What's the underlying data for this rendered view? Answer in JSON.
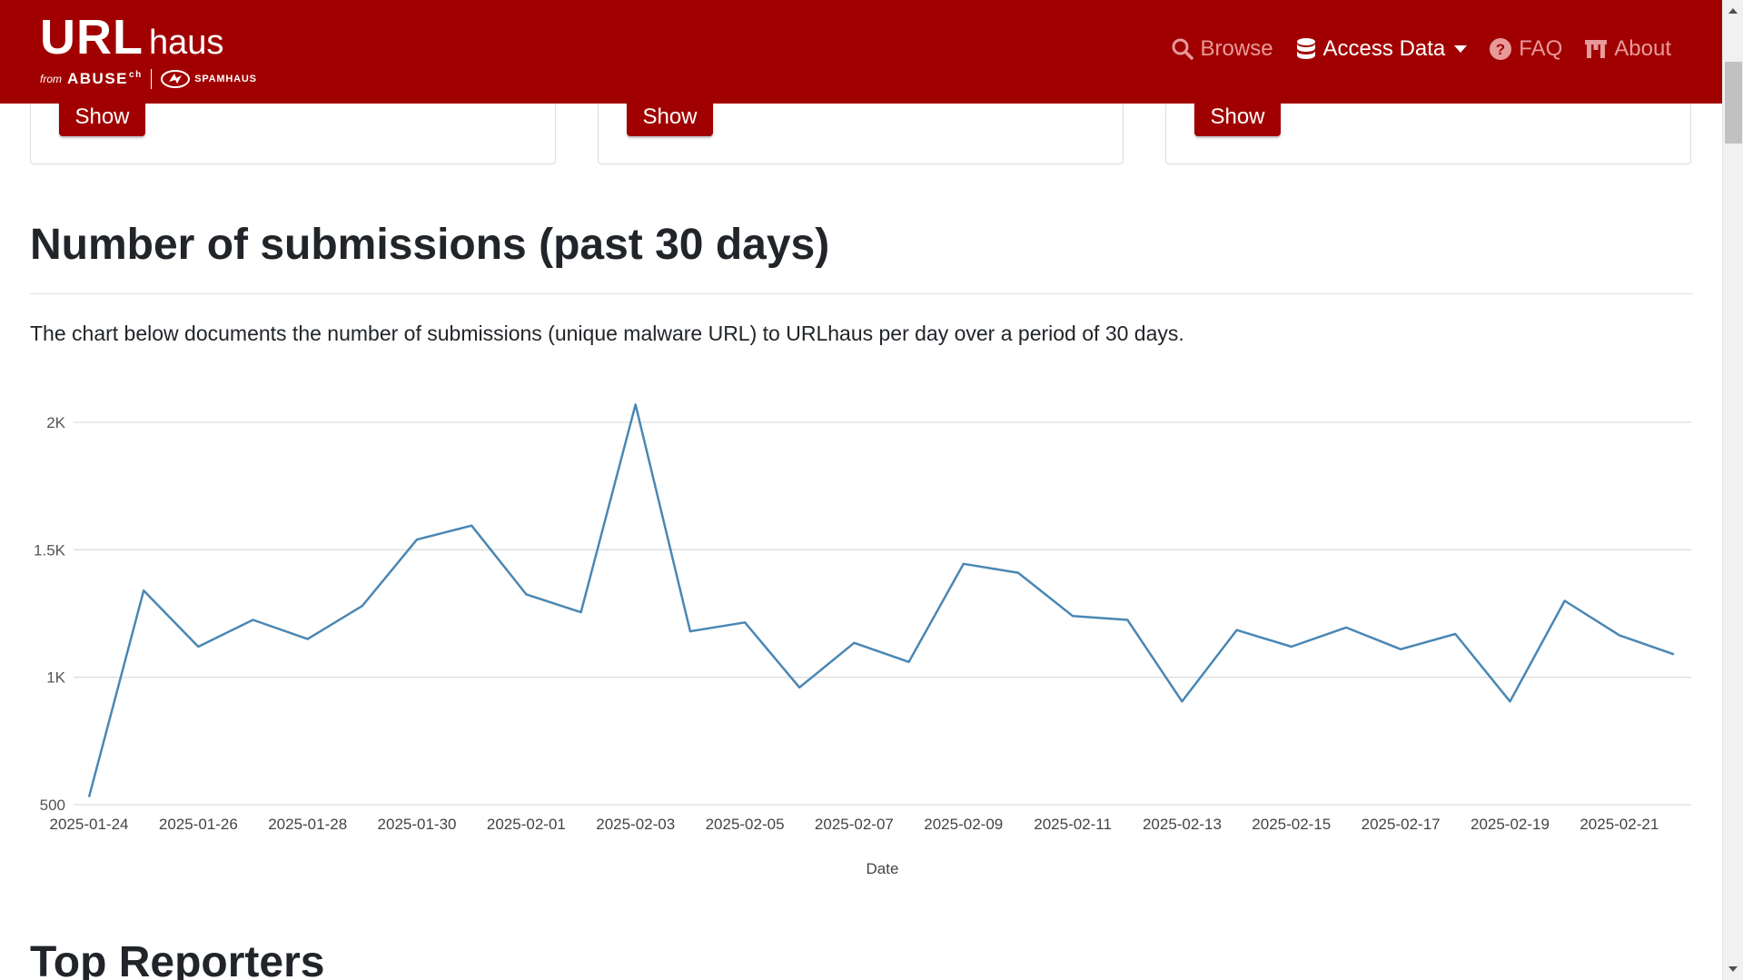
{
  "brand": {
    "url": "URL",
    "haus": "haus",
    "from": "from",
    "abuse": "ABUSE",
    "ch": "ch",
    "spamhaus": "SPAMHAUS"
  },
  "nav": {
    "browse": "Browse",
    "access_data": "Access Data",
    "faq": "FAQ",
    "about": "About"
  },
  "cards": [
    {
      "button": "Show"
    },
    {
      "button": "Show"
    },
    {
      "button": "Show"
    }
  ],
  "section": {
    "title": "Number of submissions (past 30 days)",
    "description": "The chart below documents the number of submissions (unique malware URL) to URLhaus per day over a period of 30 days."
  },
  "next_section": {
    "title": "Top Reporters"
  },
  "colors": {
    "brand": "#a10000",
    "line": "#4a87b4",
    "grid": "#dddddd"
  },
  "chart_data": {
    "type": "line",
    "title": "",
    "xlabel": "Date",
    "ylabel": "",
    "ylim": [
      500,
      2000
    ],
    "yticks": [
      500,
      1000,
      1500,
      2000
    ],
    "ytick_labels": [
      "500",
      "1K",
      "1.5K",
      "2K"
    ],
    "grid": true,
    "x": [
      "2025-01-24",
      "2025-01-25",
      "2025-01-26",
      "2025-01-27",
      "2025-01-28",
      "2025-01-29",
      "2025-01-30",
      "2025-01-31",
      "2025-02-01",
      "2025-02-02",
      "2025-02-03",
      "2025-02-04",
      "2025-02-05",
      "2025-02-06",
      "2025-02-07",
      "2025-02-08",
      "2025-02-09",
      "2025-02-10",
      "2025-02-11",
      "2025-02-12",
      "2025-02-13",
      "2025-02-14",
      "2025-02-15",
      "2025-02-16",
      "2025-02-17",
      "2025-02-18",
      "2025-02-19",
      "2025-02-20",
      "2025-02-21",
      "2025-02-22"
    ],
    "xtick_labels": [
      "2025-01-24",
      "2025-01-26",
      "2025-01-28",
      "2025-01-30",
      "2025-02-01",
      "2025-02-03",
      "2025-02-05",
      "2025-02-07",
      "2025-02-09",
      "2025-02-11",
      "2025-02-13",
      "2025-02-15",
      "2025-02-17",
      "2025-02-19",
      "2025-02-21"
    ],
    "series": [
      {
        "name": "",
        "values": [
          530,
          1340,
          1120,
          1225,
          1150,
          1280,
          1540,
          1595,
          1325,
          1255,
          2070,
          1180,
          1215,
          960,
          1135,
          1060,
          1445,
          1410,
          1240,
          1225,
          905,
          1185,
          1120,
          1195,
          1110,
          1170,
          905,
          1300,
          1165,
          1090
        ]
      }
    ]
  }
}
